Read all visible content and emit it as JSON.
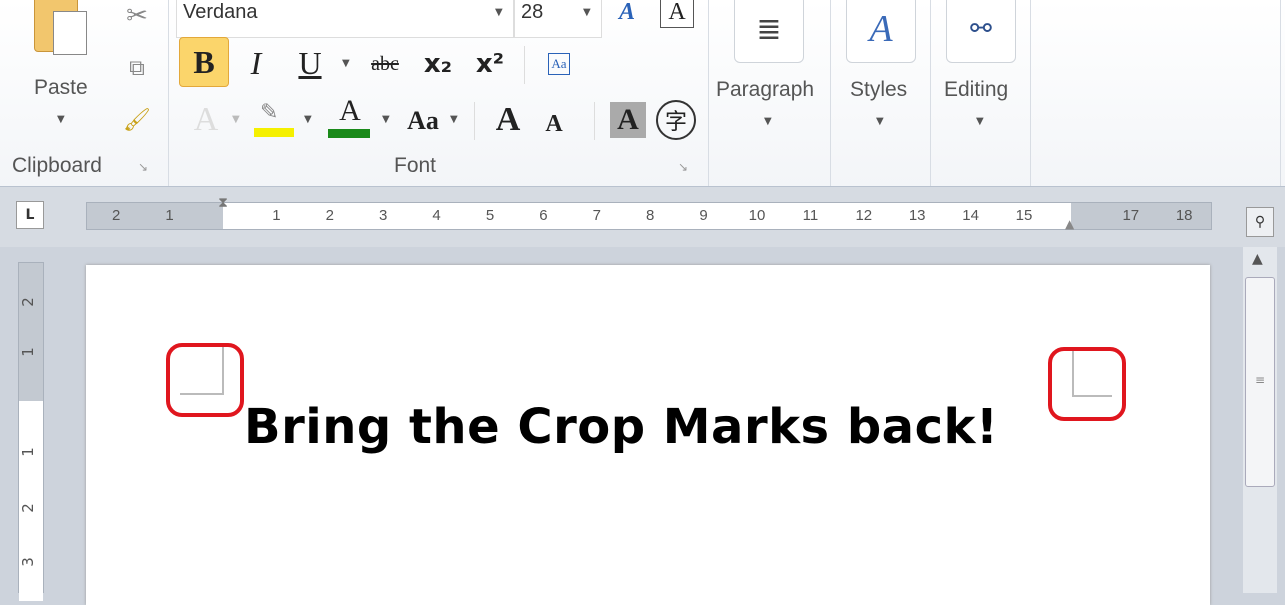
{
  "ribbon": {
    "clipboard": {
      "paste_label": "Paste",
      "group_label": "Clipboard"
    },
    "font": {
      "font_name": "Verdana",
      "font_size": "28",
      "group_label": "Font",
      "bold": "B",
      "italic": "I",
      "underline": "U",
      "strikethrough": "abc",
      "subscript": "x₂",
      "superscript": "x²",
      "grow": "A",
      "shrink": "A",
      "change_case": "Aa",
      "text_effects": "A",
      "font_color": "A",
      "shading": "A",
      "enclose": "字",
      "highlight_color": "#f5f000",
      "font_color_value": "#1a8a1a"
    },
    "paragraph": {
      "label": "Paragraph"
    },
    "styles": {
      "label": "Styles"
    },
    "editing": {
      "label": "Editing"
    }
  },
  "ruler": {
    "tab_selector": "L",
    "left_numbers": [
      "2",
      "1"
    ],
    "numbers": [
      "1",
      "2",
      "3",
      "4",
      "5",
      "6",
      "7",
      "8",
      "9",
      "10",
      "11",
      "12",
      "13",
      "14",
      "15"
    ],
    "right_numbers": [
      "17",
      "18"
    ],
    "vertical_numbers": [
      "2",
      "1",
      "1",
      "2",
      "3"
    ]
  },
  "document": {
    "text": "Bring the Crop Marks back!",
    "highlight_color": "#e0161e"
  }
}
